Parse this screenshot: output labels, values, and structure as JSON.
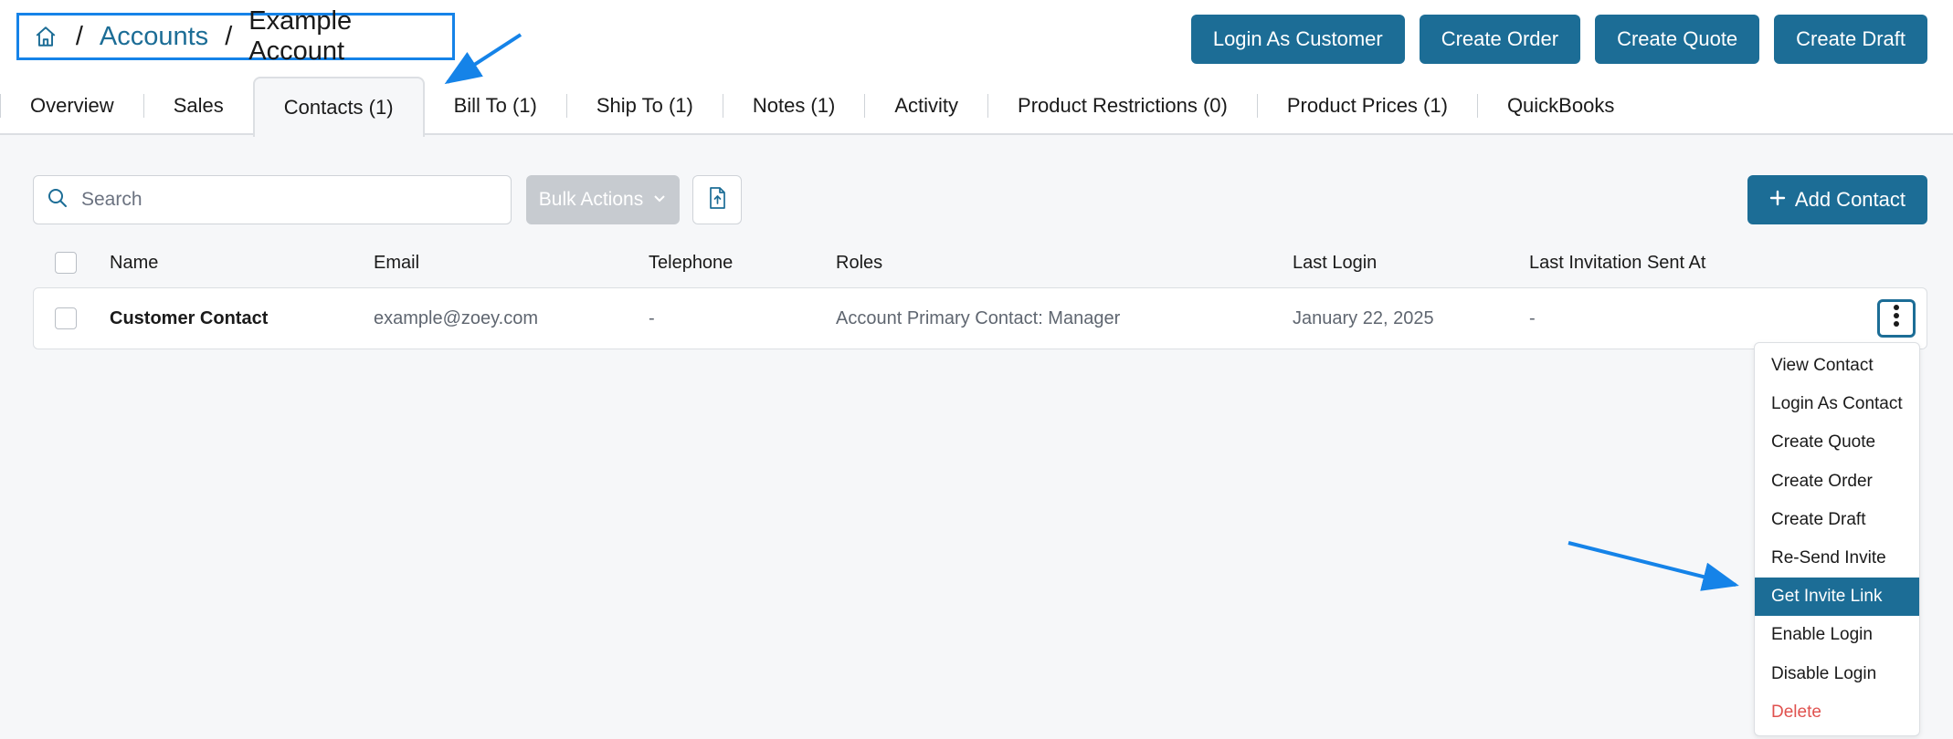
{
  "breadcrumb": {
    "home_icon": "home-icon",
    "separator": "/",
    "accounts": "Accounts",
    "current": "Example Account"
  },
  "header_actions": [
    {
      "label": "Login As Customer"
    },
    {
      "label": "Create Order"
    },
    {
      "label": "Create Quote"
    },
    {
      "label": "Create Draft"
    }
  ],
  "tabs": [
    {
      "label": "Overview"
    },
    {
      "label": "Sales"
    },
    {
      "label": "Contacts (1)",
      "active": true
    },
    {
      "label": "Bill To (1)"
    },
    {
      "label": "Ship To (1)"
    },
    {
      "label": "Notes (1)"
    },
    {
      "label": "Activity"
    },
    {
      "label": "Product Restrictions (0)"
    },
    {
      "label": "Product Prices (1)"
    },
    {
      "label": "QuickBooks"
    }
  ],
  "toolbar": {
    "search_placeholder": "Search",
    "bulk_actions": "Bulk Actions",
    "add_contact": "Add Contact"
  },
  "table": {
    "columns": [
      "Name",
      "Email",
      "Telephone",
      "Roles",
      "Last Login",
      "Last Invitation Sent At"
    ],
    "rows": [
      {
        "name": "Customer Contact",
        "email": "example@zoey.com",
        "telephone": "-",
        "roles": "Account Primary Contact: Manager",
        "last_login": "January 22, 2025",
        "last_invitation": "-"
      }
    ]
  },
  "row_menu": [
    {
      "label": "View Contact"
    },
    {
      "label": "Login As Contact"
    },
    {
      "label": "Create Quote"
    },
    {
      "label": "Create Order"
    },
    {
      "label": "Create Draft"
    },
    {
      "label": "Re-Send Invite"
    },
    {
      "label": "Get Invite Link",
      "highlighted": true
    },
    {
      "label": "Enable Login"
    },
    {
      "label": "Disable Login"
    },
    {
      "label": "Delete",
      "danger": true
    }
  ],
  "colors": {
    "primary": "#1c6d96",
    "annotation": "#1583e8",
    "danger": "#e0524f",
    "disabled": "#c7cbd0"
  }
}
